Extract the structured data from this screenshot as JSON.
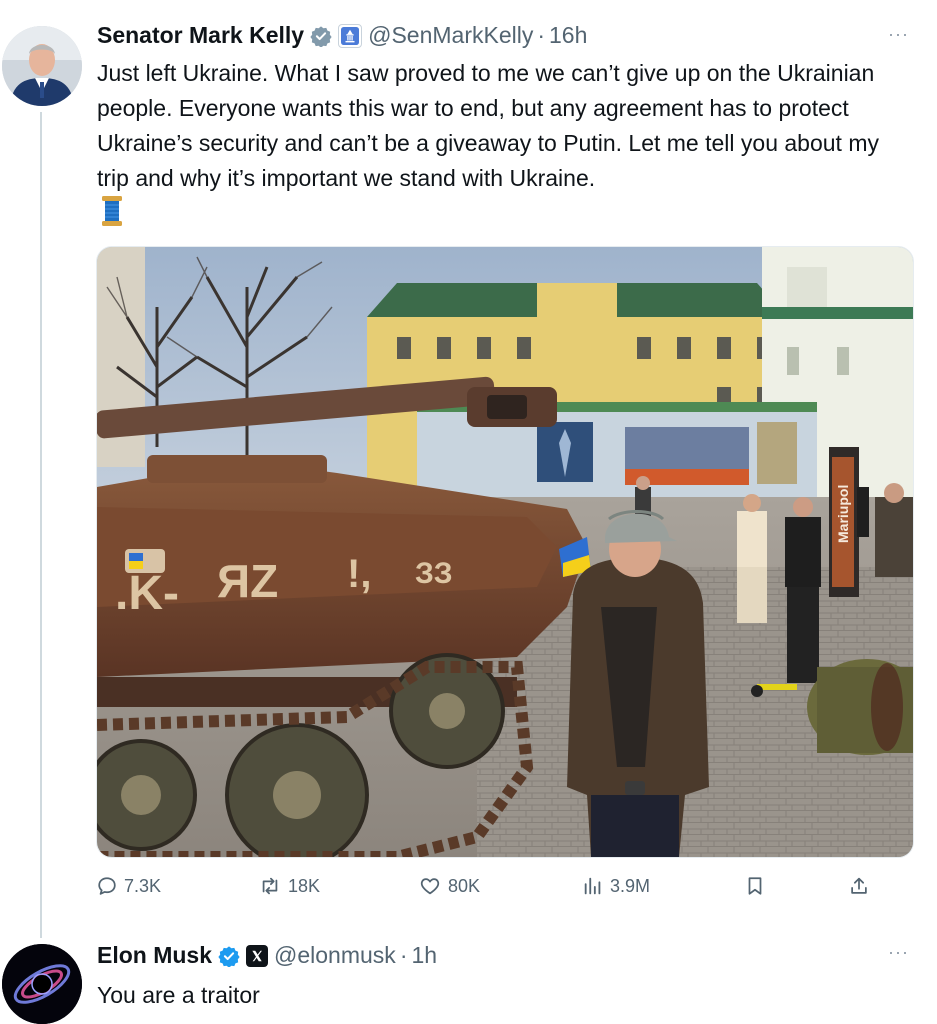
{
  "tweet": {
    "author_name": "Senator Mark Kelly",
    "handle": "@SenMarkKelly",
    "separator": "·",
    "time": "16h",
    "more_label": "···",
    "text": "Just left Ukraine. What I saw proved to me we can’t give up on the Ukrainian people. Everyone wants this war to end, but any agreement has to protect Ukraine’s security and can’t be a giveaway to Putin. Let me tell you about my trip and why it’s important we stand with Ukraine.",
    "emoji_icon": "spool-of-thread-icon",
    "media": {
      "sign_text": "Mariupol"
    },
    "actions": {
      "replies": "7.3K",
      "reposts": "18K",
      "likes": "80K",
      "views": "3.9M"
    }
  },
  "reply": {
    "author_name": "Elon Musk",
    "handle": "@elonmusk",
    "separator": "·",
    "time": "1h",
    "more_label": "···",
    "text": "You are a traitor"
  },
  "colors": {
    "verified_blue": "#1d9bf0",
    "gov_badge": "#829aab",
    "text_primary": "#0f1419",
    "text_secondary": "#536471",
    "thread_line": "#cfd9de"
  }
}
